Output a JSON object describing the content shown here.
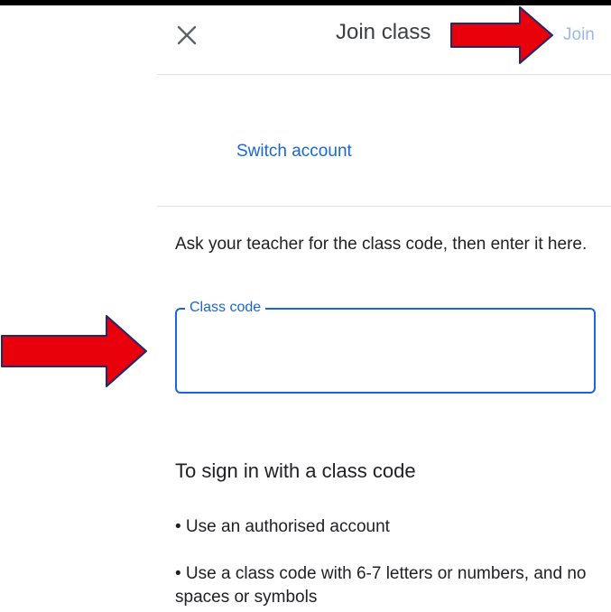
{
  "header": {
    "close_icon": "close-icon",
    "title": "Join class",
    "join_label": "Join"
  },
  "account": {
    "switch_label": "Switch account"
  },
  "form": {
    "instructions": "Ask your teacher for the class code, then enter it here.",
    "field_label": "Class code",
    "field_value": ""
  },
  "help": {
    "heading": "To sign in with a class code",
    "bullets": [
      "• Use an authorised account",
      "• Use a class code with 6-7 letters or numbers, and no spaces or symbols"
    ]
  },
  "annotations": {
    "arrow_color": "#e8000b",
    "arrow_outline": "#1e2a6e"
  }
}
